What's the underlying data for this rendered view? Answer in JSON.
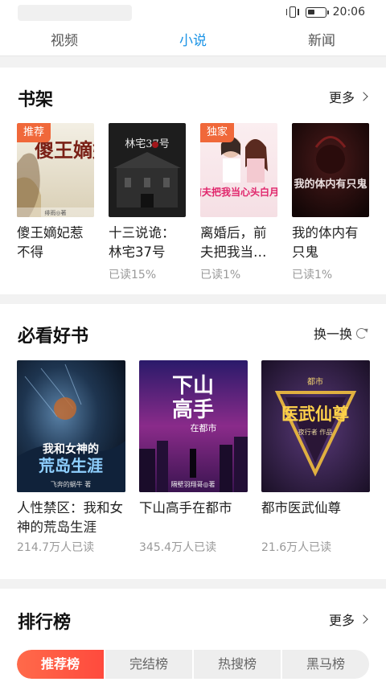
{
  "status_bar": {
    "time": "20:06"
  },
  "top_nav": {
    "tabs": [
      {
        "label": "视频"
      },
      {
        "label": "小说"
      },
      {
        "label": "新闻"
      }
    ],
    "active": "小说"
  },
  "shelf": {
    "title": "书架",
    "more_label": "更多",
    "books": [
      {
        "title": "傻王嫡妃惹不得",
        "progress": "",
        "badge": "推荐",
        "cover_text": "傻王嫡妃",
        "cover_author": "绯雨◎著"
      },
      {
        "title": "十三说诡：林宅37号",
        "progress": "已读15%",
        "badge": "",
        "cover_text": "林宅37号",
        "cover_author": ""
      },
      {
        "title": "离婚后，前夫把我当…",
        "progress": "已读1%",
        "badge": "独家",
        "cover_text": "前夫把我当心头白月光",
        "cover_author": ""
      },
      {
        "title": "我的体内有只鬼",
        "progress": "已读1%",
        "badge": "",
        "cover_text": "我的体内有只鬼",
        "cover_author": ""
      }
    ]
  },
  "must_read": {
    "title": "必看好书",
    "refresh_label": "换一换",
    "books": [
      {
        "title": "人性禁区：我和女神的荒岛生涯",
        "readers": "214.7万人已读",
        "cover_text_1": "我和女神的",
        "cover_text_2": "荒岛生涯",
        "cover_author": "飞奔的蜗牛 著"
      },
      {
        "title": "下山高手在都市",
        "readers": "345.4万人已读",
        "cover_text_1": "下山",
        "cover_text_2": "高手",
        "cover_text_3": "在都市",
        "cover_author": "隔壁羽翔哥◎著"
      },
      {
        "title": "都市医武仙尊",
        "readers": "21.6万人已读",
        "cover_text_1": "医武仙尊",
        "cover_text_2": "都市",
        "cover_author": "夜行者 作品"
      }
    ]
  },
  "ranking": {
    "title": "排行榜",
    "more_label": "更多",
    "tabs": [
      {
        "label": "推荐榜"
      },
      {
        "label": "完结榜"
      },
      {
        "label": "热搜榜"
      },
      {
        "label": "黑马榜"
      }
    ],
    "active": "推荐榜"
  }
}
